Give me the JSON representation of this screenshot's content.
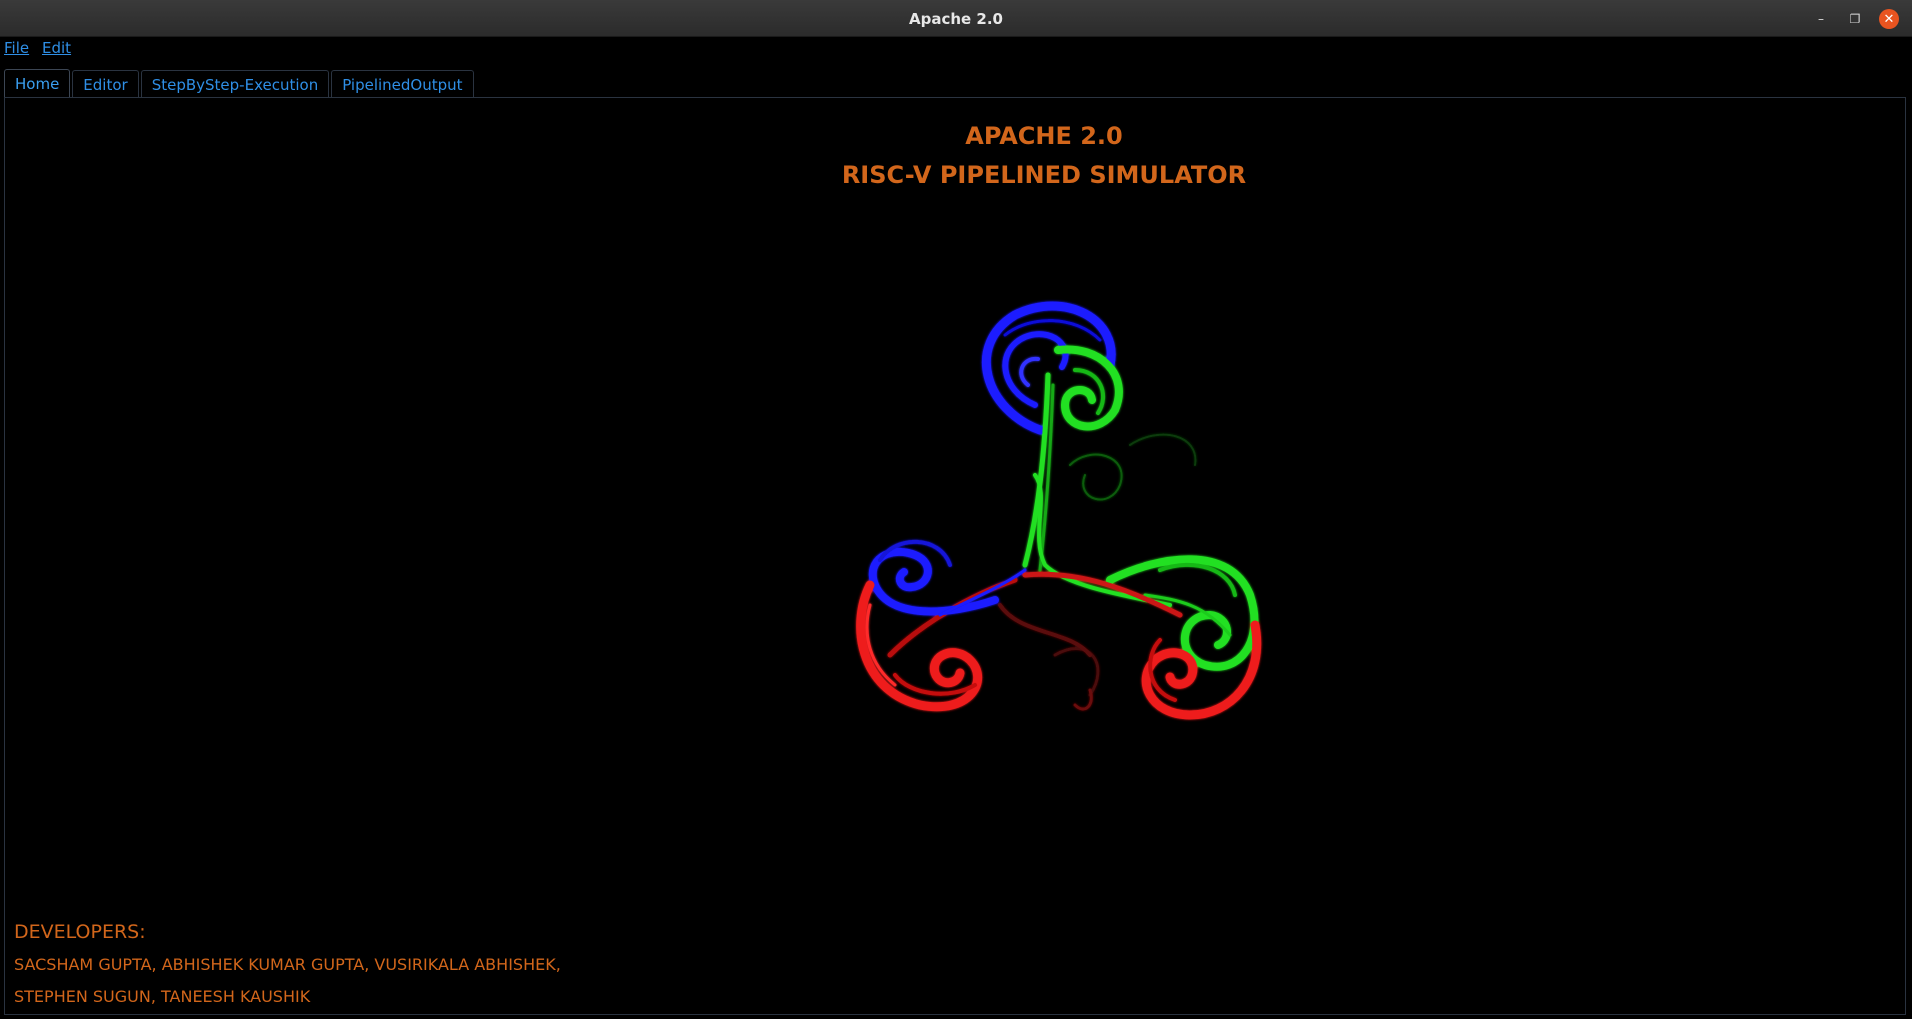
{
  "window": {
    "title": "Apache 2.0",
    "controls": {
      "minimize": "–",
      "maximize": "❐",
      "close": "✕"
    }
  },
  "menu": {
    "items": [
      {
        "label": "File"
      },
      {
        "label": "Edit"
      }
    ]
  },
  "tabs": [
    {
      "label": "Home",
      "active": true
    },
    {
      "label": "Editor",
      "active": false
    },
    {
      "label": "StepByStep-Execution",
      "active": false
    },
    {
      "label": "PipelinedOutput",
      "active": false
    }
  ],
  "home": {
    "title": "APACHE 2.0",
    "subtitle": "RISC-V PIPELINED SIMULATOR",
    "logo": "tri-swirl-logo",
    "developers_heading": "DEVELOPERS:",
    "developers_line1": "SACSHAM GUPTA, ABHISHEK KUMAR GUPTA, VUSIRIKALA ABHISHEK,",
    "developers_line2": "STEPHEN SUGUN, TANEESH KAUSHIK"
  },
  "colors": {
    "accent_text": "#d2661b",
    "link_blue": "#2f8fe6",
    "background": "#000000",
    "swirl_blue": "#1a1aff",
    "swirl_green": "#22e022",
    "swirl_red": "#ee1a1a"
  }
}
